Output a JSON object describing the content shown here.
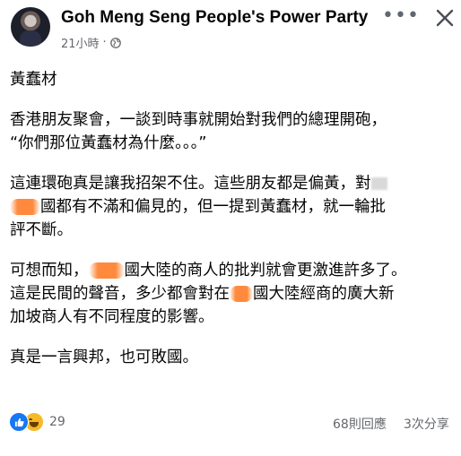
{
  "post": {
    "page_name": "Goh Meng Seng People's Power Party",
    "time": "21小時",
    "separator": "·",
    "privacy_icon": "globe-icon",
    "paragraphs": [
      [
        "黃蠢材"
      ],
      [
        "香港朋友聚會，一談到時事就開始對我們的總理開砲，",
        "“你們那位黃蠢材為什麼。。。”"
      ],
      [
        "這連環砲真是讓我招架不住。這些朋友都是偏黃，對",
        "國都有不滿和偏見的，但一提到黃蠢材，就一輪批",
        "評不斷。"
      ],
      [
        "可想而知，",
        "國大陸的商人的批判就會更激進許多了。",
        "這是民間的聲音，多少都會對在",
        "國大陸經商的廣大新",
        "加坡商人有不同程度的影響。"
      ],
      [
        "真是一言興邦，也可敗國。"
      ]
    ]
  },
  "footer": {
    "reaction_icons": [
      "like-icon",
      "haha-icon"
    ],
    "reaction_count": "29",
    "comments": "68則回應",
    "shares": "3次分享"
  },
  "colors": {
    "accent": "#1877f2",
    "secondary_text": "#65676b",
    "redaction": "#ff8a3d"
  }
}
